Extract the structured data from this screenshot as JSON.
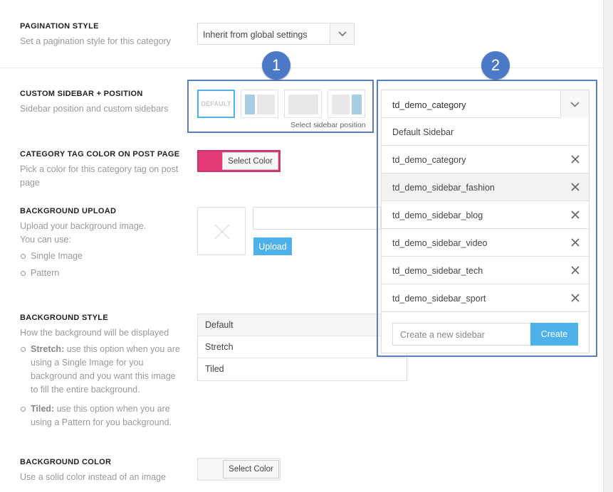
{
  "pagination": {
    "label": "PAGINATION STYLE",
    "desc": "Set a pagination style for this category",
    "selected": "Inherit from global settings"
  },
  "sidebar": {
    "label": "CUSTOM SIDEBAR + POSITION",
    "desc": "Sidebar position and custom sidebars",
    "positions": [
      "DEFAULT",
      "left-sidebar",
      "no-sidebar",
      "right-sidebar"
    ],
    "position_note": "Select sidebar position",
    "selected": "td_demo_category",
    "options": [
      {
        "name": "Default Sidebar",
        "removable": false
      },
      {
        "name": "td_demo_category",
        "removable": true
      },
      {
        "name": "td_demo_sidebar_fashion",
        "removable": true
      },
      {
        "name": "td_demo_sidebar_blog",
        "removable": true
      },
      {
        "name": "td_demo_sidebar_video",
        "removable": true
      },
      {
        "name": "td_demo_sidebar_tech",
        "removable": true
      },
      {
        "name": "td_demo_sidebar_sport",
        "removable": true
      }
    ],
    "new_placeholder": "Create a new sidebar",
    "create_label": "Create",
    "hovered_index": 2
  },
  "tag_color": {
    "label": "CATEGORY TAG COLOR ON POST PAGE",
    "desc_line1": "Pick a color for this category tag on post",
    "desc_line2": "page",
    "button": "Select Color",
    "swatch": "#e33b77"
  },
  "bg_upload": {
    "label": "BACKGROUND UPLOAD",
    "desc_line1": "Upload your background image.",
    "desc_line2": "You can use:",
    "items": [
      "Single Image",
      "Pattern"
    ],
    "upload_label": "Upload"
  },
  "bg_style": {
    "label": "BACKGROUND STYLE",
    "desc": "How the background will be displayed",
    "stretch_title": "Stretch:",
    "stretch_text": " use this option when you are using a Single Image for you background and you want this image to fill the entire background.",
    "tiled_title": "Tiled:",
    "tiled_text": " use this option when you are using a Pattern for you background.",
    "options": [
      "Default",
      "Stretch",
      "Tiled"
    ]
  },
  "bg_color": {
    "label": "BACKGROUND COLOR",
    "desc": "Use a solid color instead of an image",
    "button": "Select Color"
  },
  "annotations": [
    "1",
    "2"
  ],
  "colors": {
    "accent": "#4db2ec",
    "annotation": "#4b79c7",
    "annotation_border": "#5a7fc1",
    "tag_border": "#c7366f"
  }
}
